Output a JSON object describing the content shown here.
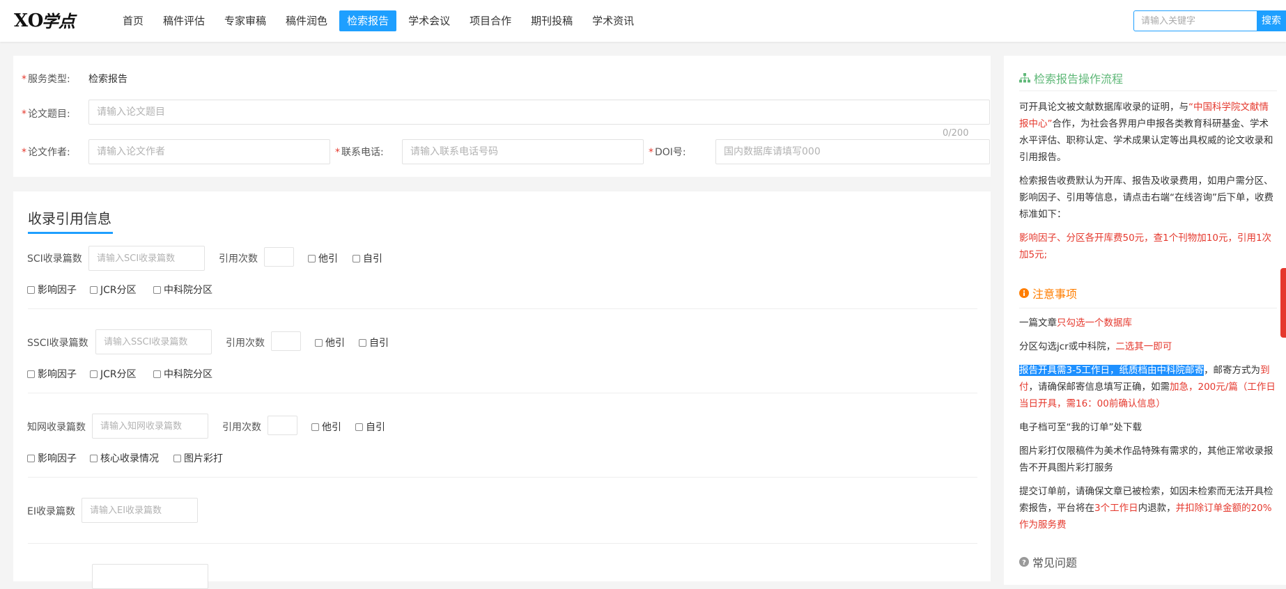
{
  "header": {
    "logo_text": "XO学点",
    "nav": [
      {
        "label": "首页",
        "active": false
      },
      {
        "label": "稿件评估",
        "active": false
      },
      {
        "label": "专家审稿",
        "active": false
      },
      {
        "label": "稿件润色",
        "active": false
      },
      {
        "label": "检索报告",
        "active": true
      },
      {
        "label": "学术会议",
        "active": false
      },
      {
        "label": "项目合作",
        "active": false
      },
      {
        "label": "期刊投稿",
        "active": false
      },
      {
        "label": "学术资讯",
        "active": false
      }
    ],
    "search": {
      "placeholder": "请输入关键字",
      "button_label": "搜索"
    }
  },
  "basic_form": {
    "service_type_label": "服务类型:",
    "service_type_value": "检索报告",
    "title_label": "论文题目:",
    "title_placeholder": "请输入论文题目",
    "title_counter": "0/200",
    "author_label": "论文作者:",
    "author_placeholder": "请输入论文作者",
    "phone_label": "联系电话:",
    "phone_placeholder": "请输入联系电话号码",
    "doi_label": "DOI号:",
    "doi_placeholder": "国内数据库请填写000"
  },
  "citation": {
    "title": "收录引用信息",
    "cite_label": "引用次数",
    "other_cite": "他引",
    "self_cite": "自引",
    "impact_factor": "影响因子",
    "jcr": "JCR分区",
    "cas": "中科院分区",
    "core": "核心收录情况",
    "color_print": "图片彩打",
    "sci_label": "SCI收录篇数",
    "sci_placeholder": "请输入SCI收录篇数",
    "ssci_label": "SSCI收录篇数",
    "ssci_placeholder": "请输入SSCI收录篇数",
    "cnki_label": "知网收录篇数",
    "cnki_placeholder": "请输入知网收录篇数",
    "ei_label": "EI收录篇数",
    "ei_placeholder": "请输入EI收录篇数"
  },
  "sidebar": {
    "process_title": "检索报告操作流程",
    "p1_a": "可开具论文被文献数据库收录的证明，与",
    "p1_b": "“中国科学院文献情报中心”",
    "p1_c": "合作，为社会各界用户申报各类教育科研基金、学术水平评估、职称认定、学术成果认定等出具权威的论文收录和引用报告。",
    "p2": "检索报告收费默认为开库、报告及收录费用，如用户需分区、影响因子、引用等信息，请点击右端“在线咨询”后下单，收费标准如下：",
    "p3": "影响因子、分区各开库费50元，查1个刊物加10元，引用1次加5元;",
    "notice_title": "注意事项",
    "n1_a": "一篇文章",
    "n1_b": "只勾选一个数据库",
    "n2_a": "分区勾选jcr或中科院，",
    "n2_b": "二选其一即可",
    "n3_a": "报告开具需3-5工作日，纸质档由中科院邮寄",
    "n3_b": "，邮寄方式为",
    "n3_c": "到付",
    "n3_d": "，请确保邮寄信息填写正确，如需",
    "n3_e": "加急，200元/篇（工作日当日开具，需16：00前确认信息）",
    "n4": "电子档可至“我的订单”处下载",
    "n5": "图片彩打仅限稿件为美术作品特殊有需求的，其他正常收录报告不开具图片彩打服务",
    "n6_a": "提交订单前，请确保文章已被检索，如因未检索而无法开具检索报告，平台将在",
    "n6_b": "3个工作日",
    "n6_c": "内退款，",
    "n6_d": "并扣除订单金额的20%作为服务费",
    "faq_title": "常见问题",
    "accent_green": "#5fb878",
    "accent_orange": "#ff7e00",
    "accent_red": "#e5382d"
  }
}
